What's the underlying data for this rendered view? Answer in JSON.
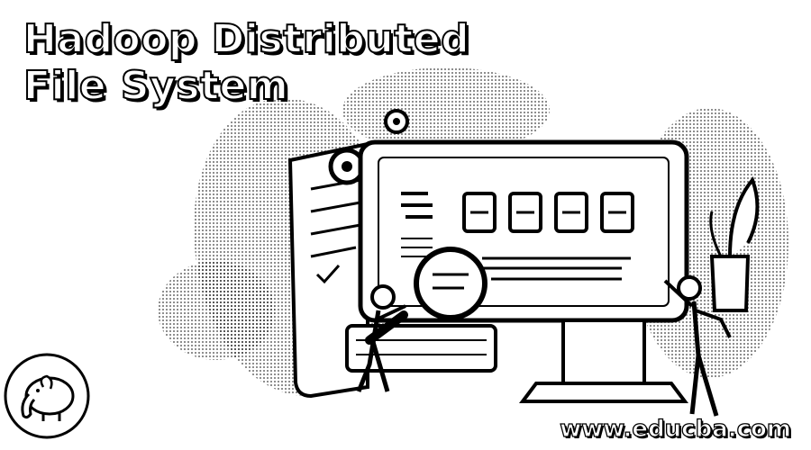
{
  "banner": {
    "title_line1": "Hadoop Distributed",
    "title_line2": "File System",
    "website": "www.educba.com",
    "logo_icon": "hadoop-elephant-icon",
    "colors": {
      "background": "#ffffff",
      "ink": "#000000"
    }
  }
}
